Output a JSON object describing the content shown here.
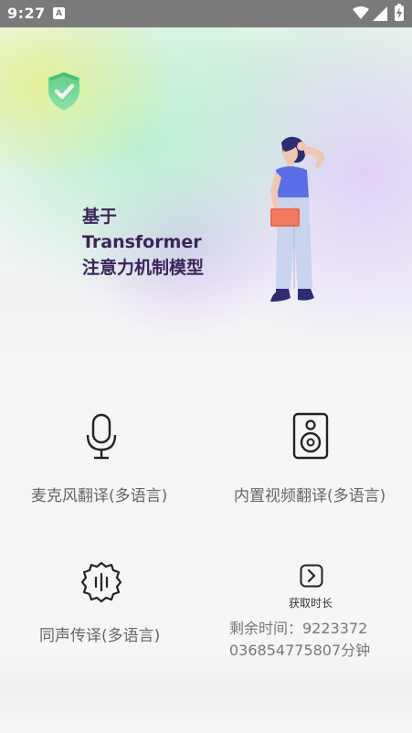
{
  "status_bar": {
    "time": "9:27",
    "notification_icon": "a-icon",
    "wifi_icon": "wifi-icon",
    "signal_icon": "signal-icon",
    "battery_icon": "battery-charging-icon"
  },
  "hero": {
    "line1": "基于",
    "line2": "Transformer",
    "line3": "注意力机制模型",
    "shield_icon": "shield-check-icon",
    "accent": "#3b2459"
  },
  "features": {
    "mic": {
      "label": "麦克风翻译(多语言)",
      "icon": "microphone-icon"
    },
    "video": {
      "label": "内置视频翻译(多语言)",
      "icon": "speaker-icon"
    },
    "simul": {
      "label": "同声传译(多语言)",
      "icon": "sound-wave-badge-icon"
    },
    "get_time": {
      "label": "获取时长",
      "icon": "play-next-icon"
    }
  },
  "remaining_time": "剩余时间：9223372036854775807分钟"
}
